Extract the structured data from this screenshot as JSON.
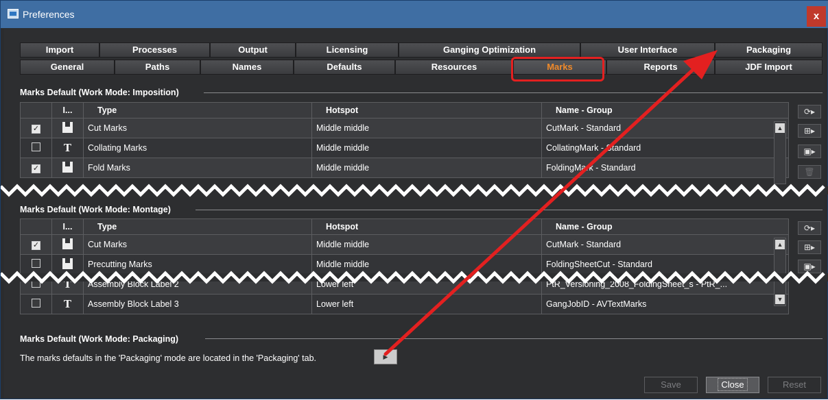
{
  "window": {
    "title": "Preferences",
    "close_label": "x"
  },
  "tabs": {
    "row1": [
      "Import",
      "Processes",
      "Output",
      "Licensing",
      "Ganging Optimization",
      "User Interface",
      "Packaging"
    ],
    "row2": [
      "General",
      "Paths",
      "Names",
      "Defaults",
      "Resources",
      "Marks",
      "Reports",
      "JDF Import"
    ],
    "active": "Marks"
  },
  "imposition": {
    "title": "Marks Default (Work Mode: Imposition)",
    "headers": [
      "",
      "I...",
      "Type",
      "Hotspot",
      "Name - Group"
    ],
    "rows": [
      {
        "checked": true,
        "icon": "mark-icon",
        "type": "Cut Marks",
        "hotspot": "Middle middle",
        "name": "CutMark - Standard"
      },
      {
        "checked": false,
        "icon": "text-icon",
        "icon_glyph": "T",
        "type": "Collating Marks",
        "hotspot": "Middle middle",
        "name": "CollatingMark - Standard"
      },
      {
        "checked": true,
        "icon": "mark-icon",
        "type": "Fold Marks",
        "hotspot": "Middle middle",
        "name": "FoldingMark - Standard"
      }
    ]
  },
  "montage": {
    "title": "Marks Default (Work Mode: Montage)",
    "headers": [
      "",
      "I...",
      "Type",
      "Hotspot",
      "Name - Group"
    ],
    "rows": [
      {
        "checked": true,
        "icon": "mark-icon",
        "type": "Cut Marks",
        "hotspot": "Middle middle",
        "name": "CutMark - Standard"
      },
      {
        "checked": false,
        "icon": "mark-icon",
        "type": "Precutting Marks",
        "hotspot": "Middle middle",
        "name": "FoldingSheetCut - Standard"
      },
      {
        "checked": false,
        "icon": "text-icon",
        "icon_glyph": "T",
        "type": "Assembly Block Label 2",
        "hotspot": "Lower left",
        "name": "PtR_Versioning_2008_FoldingSheet_s - PtR_..."
      },
      {
        "checked": false,
        "icon": "text-icon",
        "icon_glyph": "T",
        "type": "Assembly Block Label 3",
        "hotspot": "Lower left",
        "name": "GangJobID - AVTextMarks"
      }
    ]
  },
  "packaging": {
    "title": "Marks Default (Work Mode: Packaging)",
    "info": "The marks defaults in the 'Packaging' mode are located in the 'Packaging' tab."
  },
  "side_icons": [
    "refresh-icon",
    "add-mark-icon",
    "copy-icon",
    "trash-icon"
  ],
  "footer": {
    "save": "Save",
    "close": "Close",
    "reset": "Reset"
  },
  "colors": {
    "accent": "#f08a2a",
    "highlight": "#e32020",
    "titlebar": "#3f6ea3"
  }
}
